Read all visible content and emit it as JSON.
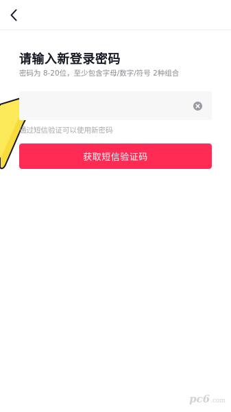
{
  "screen": {
    "title": "请输入新登录密码",
    "subtitle": "密码为 8-20位，至少包含字母/数字/符号 2种组合"
  },
  "password_field": {
    "value": "",
    "placeholder": "",
    "clear_icon": "clear-circle-icon"
  },
  "hint": "通过短信验证可以使用新密码",
  "primary_button": {
    "label": "获取短信验证码"
  },
  "nav": {
    "back_icon": "chevron-left-icon"
  },
  "watermark": {
    "text": "pc6",
    "suffix": ".com"
  },
  "colors": {
    "accent": "#fe2c55",
    "field_bg": "#f7f7f8",
    "subtitle": "#8a8b91",
    "hint": "#a7a8ad"
  }
}
